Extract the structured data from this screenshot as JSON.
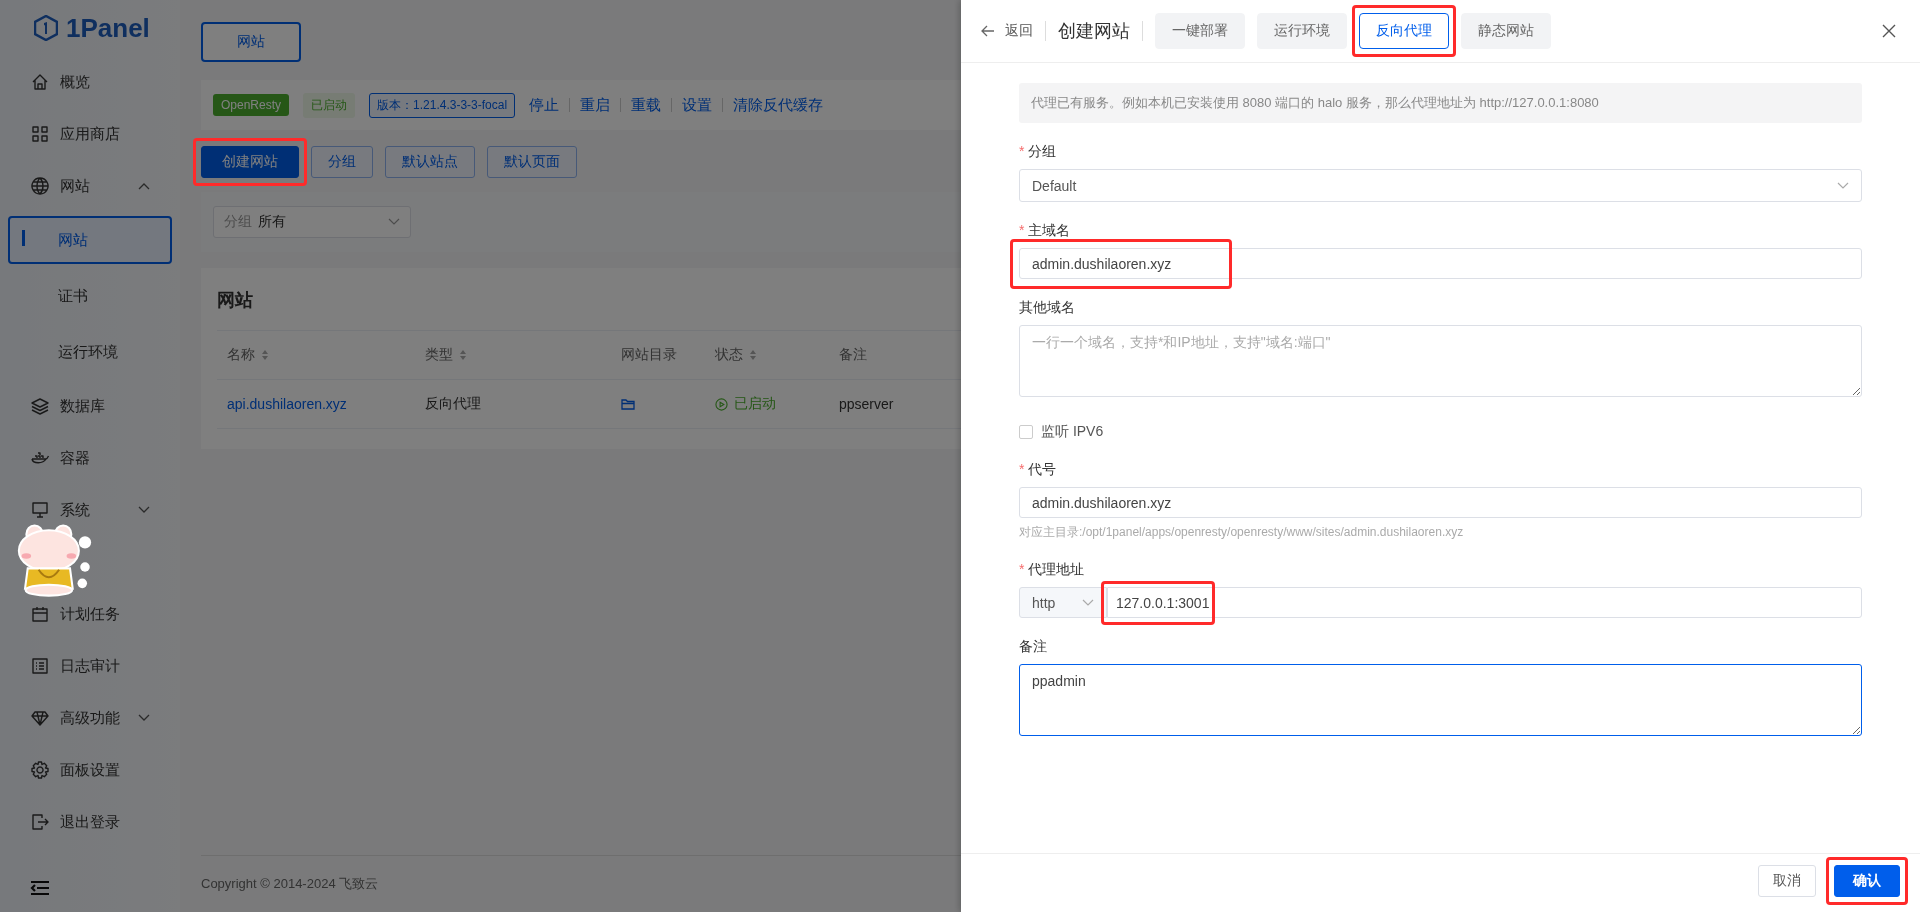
{
  "sidebar": {
    "logo": "1Panel",
    "items": [
      {
        "kind": "link",
        "label": "概览",
        "selected": false
      },
      {
        "kind": "link",
        "label": "应用商店",
        "selected": false
      },
      {
        "kind": "group",
        "label": "网站",
        "expanded": true,
        "children": [
          {
            "label": "网站",
            "selected": true
          },
          {
            "label": "证书",
            "selected": false
          },
          {
            "label": "运行环境",
            "selected": false
          }
        ]
      },
      {
        "kind": "link",
        "label": "数据库",
        "selected": false
      },
      {
        "kind": "link",
        "label": "容器",
        "selected": false
      },
      {
        "kind": "group",
        "label": "系统",
        "expanded": false
      },
      {
        "kind": "picture"
      },
      {
        "kind": "link",
        "label": "计划任务",
        "selected": false
      },
      {
        "kind": "link",
        "label": "日志审计",
        "selected": false
      },
      {
        "kind": "group",
        "label": "高级功能",
        "expanded": false
      },
      {
        "kind": "link",
        "label": "面板设置",
        "selected": false
      },
      {
        "kind": "link",
        "label": "退出登录",
        "selected": false
      }
    ]
  },
  "page_tab": "网站",
  "server": {
    "name": "OpenResty",
    "status": "已启动",
    "version": "版本：1.21.4.3-3-3-focal",
    "actions": [
      "停止",
      "重启",
      "重载",
      "设置",
      "清除反代缓存"
    ]
  },
  "toolbar": [
    {
      "label": "创建网站",
      "primary": true,
      "highlighted": true
    },
    {
      "label": "分组",
      "primary": false
    },
    {
      "label": "默认站点",
      "primary": false
    },
    {
      "label": "默认页面",
      "primary": false
    }
  ],
  "filter": {
    "label": "分组",
    "value": "所有"
  },
  "table": {
    "title": "网站",
    "columns": [
      {
        "label": "名称",
        "sortable": true
      },
      {
        "label": "类型",
        "sortable": true
      },
      {
        "label": "网站目录",
        "sortable": false
      },
      {
        "label": "状态",
        "sortable": true
      },
      {
        "label": "备注",
        "sortable": false
      }
    ],
    "rows": [
      {
        "name": "api.dushilaoren.xyz",
        "type": "反向代理",
        "status": "已启动",
        "remark": "ppserver"
      }
    ]
  },
  "footer": "Copyright © 2014-2024 飞致云",
  "drawer": {
    "back": "返回",
    "title": "创建网站",
    "tabs": [
      {
        "label": "一键部署",
        "selected": false
      },
      {
        "label": "运行环境",
        "selected": false
      },
      {
        "label": "反向代理",
        "selected": true,
        "highlighted": true
      },
      {
        "label": "静态网站",
        "selected": false
      }
    ],
    "alert": "代理已有服务。例如本机已安装使用 8080 端口的 halo 服务，那么代理地址为 http://127.0.0.1:8080",
    "fields": [
      {
        "kind": "select",
        "required_mark": "*",
        "label": "分组",
        "value": "Default"
      },
      {
        "kind": "input",
        "required_mark": "*",
        "label": "主域名",
        "value": "admin.dushilaoren.xyz",
        "highlighted": true
      },
      {
        "kind": "textarea",
        "label": "其他域名",
        "focused": false,
        "placeholder": "一行一个域名，支持*和IP地址，支持\"域名:端口\""
      },
      {
        "kind": "checkbox",
        "label": "监听 IPV6",
        "checked": false
      },
      {
        "kind": "input",
        "required_mark": "*",
        "label": "代号",
        "value": "admin.dushilaoren.xyz",
        "hint": "对应主目录:/opt/1panel/apps/openresty/openresty/www/sites/admin.dushilaoren.xyz"
      },
      {
        "kind": "address",
        "required_mark": "*",
        "label": "代理地址",
        "scheme": "http",
        "value": "127.0.0.1:3001",
        "highlighted": true
      },
      {
        "kind": "textarea",
        "label": "备注",
        "value": "ppadmin",
        "focused": true
      }
    ],
    "buttons": [
      {
        "label": "取消",
        "primary": false
      },
      {
        "label": "确认",
        "primary": true,
        "highlighted": true
      }
    ]
  }
}
